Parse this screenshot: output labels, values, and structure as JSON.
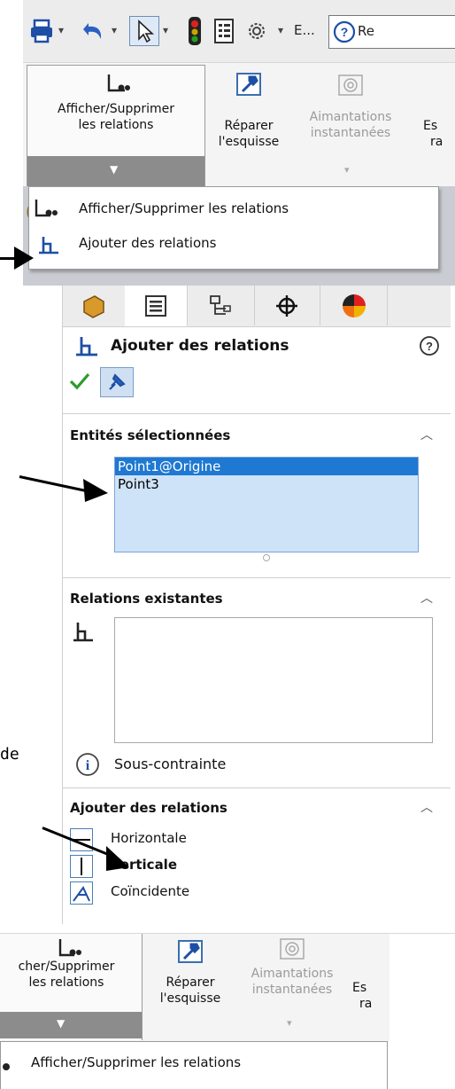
{
  "qat": {
    "overflow_label": "E...",
    "help_label": "Re"
  },
  "ribbon_top": {
    "btn_relations": {
      "line1": "Afficher/Supprimer",
      "line2": "les relations"
    },
    "btn_repair": {
      "line1": "Réparer",
      "line2": "l'esquisse"
    },
    "btn_snaps": {
      "line1": "Aimantations",
      "line2": "instantanées"
    },
    "btn_cut": {
      "line1": "Es",
      "line2": "ra"
    }
  },
  "dropdown_top": {
    "items": [
      {
        "label": "Afficher/Supprimer les relations"
      },
      {
        "label": "Ajouter des relations"
      }
    ]
  },
  "property_manager": {
    "title": "Ajouter des relations",
    "help": "?",
    "sections": {
      "selected_entities": {
        "title": "Entités sélectionnées",
        "items": [
          "Point1@Origine",
          "Point3"
        ]
      },
      "existing_relations": {
        "title": "Relations existantes",
        "status": "Sous-contrainte"
      },
      "add_relations": {
        "title": "Ajouter des relations",
        "items": [
          {
            "label": "Horizontale",
            "bold": false
          },
          {
            "label": "Verticale",
            "bold": true
          },
          {
            "label": "Coïncidente",
            "bold": false
          }
        ]
      }
    }
  },
  "annotation": {
    "text_fragment": "de"
  },
  "ribbon_bottom": {
    "btn_relations": {
      "line1": "cher/Supprimer",
      "line2": "les relations"
    },
    "btn_repair": {
      "line1": "Réparer",
      "line2": "l'esquisse"
    },
    "btn_snaps": {
      "line1": "Aimantations",
      "line2": "instantanées"
    },
    "btn_cut": {
      "line1": "Es",
      "line2": "ra"
    },
    "dropdown_item": "Afficher/Supprimer les relations"
  }
}
